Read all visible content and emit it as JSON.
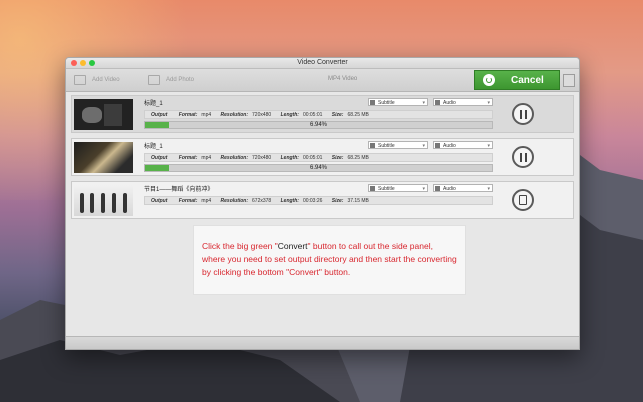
{
  "window": {
    "title": "Video Converter"
  },
  "toolbar": {
    "add_video": "Add Video",
    "add_photo": "Add Photo",
    "format": "MP4 Video",
    "cancel": "Cancel"
  },
  "labels": {
    "output": "Output",
    "format": "Format:",
    "resolution": "Resolution:",
    "length": "Length:",
    "size": "Size:",
    "subtitle": "Subtitle",
    "audio": "Audio"
  },
  "items": [
    {
      "title": "标题_1",
      "format": "mp4",
      "resolution": "720x480",
      "length": "00:05:01",
      "size": "68.25 MB",
      "progress_text": "6.94%",
      "progress": 6.94,
      "state": "converting"
    },
    {
      "title": "标题_1",
      "format": "mp4",
      "resolution": "720x480",
      "length": "00:05:01",
      "size": "68.25 MB",
      "progress_text": "6.94%",
      "progress": 6.94,
      "state": "converting"
    },
    {
      "title": "节目1——舞蹈《向前冲》",
      "format": "mp4",
      "resolution": "672x378",
      "length": "00:03:26",
      "size": "37.15 MB",
      "state": "waiting"
    }
  ],
  "tip": {
    "part1": "Click the big green \"",
    "highlight": "Convert",
    "part2": "\" button to call out the side panel, where you need to set output directory and then start the converting by clicking the bottom \"Convert\" button."
  },
  "colors": {
    "accent_green": "#58b24a",
    "tip_red": "#d8272f"
  }
}
